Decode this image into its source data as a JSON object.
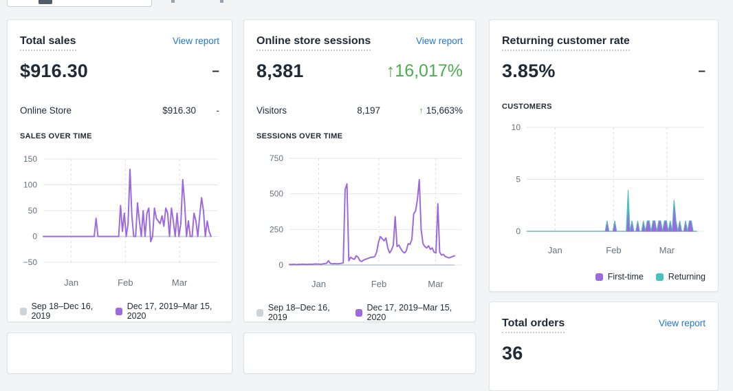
{
  "theme": {
    "background": "#f2f4f6",
    "card_bg": "#ffffff",
    "ink": "#212b36",
    "subdued": "#68737d",
    "link_blue": "#2276d3",
    "success_green": "#4aae4e",
    "viz_purple": "#9c6ade",
    "viz_teal": "#47c1bf",
    "prev_period_gray": "#ccd4da",
    "grid": "#e4e6e9",
    "grid_dashed": "#d9dbde"
  },
  "cards": {
    "total_sales": {
      "title": "Total sales",
      "view_report": "View report",
      "value": "$916.30",
      "change": "–",
      "rows": [
        {
          "label": "Online Store",
          "value": "$916.30",
          "change": "-"
        }
      ]
    },
    "sessions": {
      "title": "Online store sessions",
      "view_report": "View report",
      "value": "8,381",
      "change_arrow": "↑",
      "change_value": "16,017%",
      "rows": [
        {
          "label": "Visitors",
          "value": "8,197",
          "change_arrow": "↑",
          "change_value": "15,663%"
        }
      ]
    },
    "returning": {
      "title": "Returning customer rate",
      "value": "3.85%",
      "change": "–"
    },
    "total_orders": {
      "title": "Total orders",
      "view_report": "View report",
      "value": "36"
    }
  },
  "chart_data": [
    {
      "type": "line",
      "title": "SALES OVER TIME",
      "xlabel": "",
      "ylabel": "",
      "ylim": [
        -50,
        150
      ],
      "yticks": [
        150,
        100,
        50,
        0,
        -50
      ],
      "xticks": [
        {
          "label": "Jan",
          "pos": 0.16
        },
        {
          "label": "Feb",
          "pos": 0.47
        },
        {
          "label": "Mar",
          "pos": 0.78
        }
      ],
      "grid": "horizontal-solid, vertical-dashed",
      "legend_position": "bottom-left",
      "series": [
        {
          "name": "Sep 18–Dec 16, 2019",
          "color": "#ccd4da",
          "constant": 0
        },
        {
          "name": "Dec 17, 2019–Mar 15, 2020",
          "color": "#9c6ade",
          "values": [
            0,
            0,
            0,
            0,
            0,
            0,
            0,
            0,
            0,
            0,
            0,
            0,
            0,
            0,
            0,
            0,
            0,
            0,
            0,
            0,
            0,
            0,
            0,
            0,
            0,
            0,
            0,
            0,
            35,
            0,
            0,
            0,
            0,
            0,
            0,
            0,
            0,
            0,
            0,
            0,
            0,
            60,
            10,
            45,
            0,
            25,
            130,
            40,
            0,
            0,
            65,
            30,
            0,
            50,
            0,
            45,
            55,
            -10,
            0,
            55,
            35,
            30,
            25,
            40,
            20,
            55,
            45,
            0,
            55,
            30,
            0,
            45,
            0,
            25,
            110,
            65,
            0,
            30,
            0,
            0,
            45,
            30,
            0,
            40,
            75,
            50,
            0,
            30,
            10,
            0
          ]
        }
      ]
    },
    {
      "type": "line",
      "title": "SESSIONS OVER TIME",
      "xlabel": "",
      "ylabel": "",
      "ylim": [
        0,
        750
      ],
      "yticks": [
        750,
        500,
        250,
        0
      ],
      "xticks": [
        {
          "label": "Jan",
          "pos": 0.17
        },
        {
          "label": "Feb",
          "pos": 0.52
        },
        {
          "label": "Mar",
          "pos": 0.85
        }
      ],
      "grid": "horizontal-solid, vertical-dashed",
      "legend_position": "bottom-left",
      "series": [
        {
          "name": "Sep 18–Dec 16, 2019",
          "color": "#ccd4da",
          "constant": 0
        },
        {
          "name": "Dec 17, 2019–Mar 15, 2020",
          "color": "#9c6ade",
          "values": [
            4,
            3,
            5,
            4,
            3,
            5,
            4,
            6,
            5,
            4,
            5,
            6,
            5,
            6,
            8,
            6,
            7,
            5,
            8,
            10,
            12,
            30,
            12,
            8,
            10,
            9,
            8,
            10,
            12,
            15,
            530,
            570,
            30,
            55,
            45,
            40,
            65,
            55,
            30,
            25,
            35,
            40,
            45,
            50,
            55,
            55,
            60,
            90,
            160,
            200,
            185,
            170,
            190,
            120,
            85,
            105,
            140,
            340,
            130,
            140,
            115,
            95,
            85,
            100,
            150,
            145,
            180,
            360,
            380,
            460,
            600,
            250,
            150,
            130,
            120,
            135,
            110,
            120,
            90,
            85,
            430,
            90,
            70,
            75,
            60,
            55,
            50,
            55,
            60,
            65
          ]
        }
      ]
    },
    {
      "type": "stacked-area",
      "title": "CUSTOMERS",
      "xlabel": "",
      "ylabel": "",
      "ylim": [
        0,
        10
      ],
      "yticks": [
        10,
        5,
        0
      ],
      "xticks": [
        {
          "label": "Jan",
          "pos": 0.16
        },
        {
          "label": "Feb",
          "pos": 0.49
        },
        {
          "label": "Mar",
          "pos": 0.79
        }
      ],
      "grid": "horizontal-solid, vertical-dashed",
      "legend_position": "bottom-right",
      "series": [
        {
          "name": "First-time",
          "color": "#9c6ade",
          "values": [
            0,
            0,
            0,
            0,
            0,
            0,
            0,
            0,
            0,
            0,
            0,
            0,
            0,
            0,
            0,
            0,
            0,
            0,
            0,
            0,
            0,
            0,
            0,
            0,
            0,
            0,
            0,
            0,
            0,
            0,
            0,
            0,
            0,
            0,
            0,
            0,
            0,
            0,
            0,
            0,
            0,
            0,
            1,
            0,
            0,
            0,
            1,
            0,
            0,
            0,
            0,
            0,
            0,
            2.5,
            0,
            1,
            0,
            0,
            1,
            0,
            0,
            1,
            0,
            1,
            1,
            0,
            1,
            1,
            0,
            1,
            1,
            0,
            1,
            1,
            0,
            1,
            0,
            3,
            1,
            0,
            1,
            0,
            0,
            1,
            0,
            1,
            1,
            0,
            0,
            0
          ]
        },
        {
          "name": "Returning",
          "color": "#47c1bf",
          "values": [
            0,
            0,
            0,
            0,
            0,
            0,
            0,
            0,
            0,
            0,
            0,
            0,
            0,
            0,
            0,
            0,
            0,
            0,
            0,
            0,
            0,
            0,
            0,
            0,
            0,
            0,
            0,
            0,
            0,
            0,
            0,
            0,
            0,
            0,
            0,
            0,
            0,
            0,
            0,
            0,
            0,
            0,
            0,
            0,
            0,
            0,
            0,
            0,
            0,
            0,
            0,
            0,
            0,
            1.5,
            0,
            0,
            0,
            0,
            0,
            0,
            0,
            0,
            0,
            0,
            0,
            0,
            0,
            0,
            0,
            0,
            0,
            0,
            0,
            0,
            0,
            0,
            0,
            0,
            0,
            0,
            0,
            0,
            0,
            0,
            0,
            0,
            0,
            0,
            0,
            0
          ]
        }
      ]
    }
  ]
}
